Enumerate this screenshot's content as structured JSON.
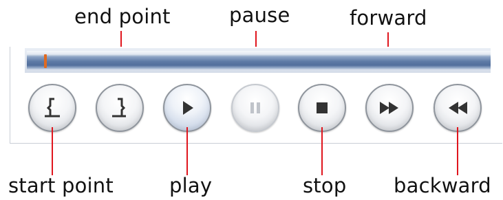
{
  "labels": {
    "end_point": "end point",
    "pause": "pause",
    "forward": "forward",
    "start_point": "start point",
    "play": "play",
    "stop": "stop",
    "backward": "backward"
  },
  "controls": [
    {
      "name": "start-point-button",
      "icon": "start-point-bracket-icon",
      "enabled": true
    },
    {
      "name": "end-point-button",
      "icon": "end-point-bracket-icon",
      "enabled": true
    },
    {
      "name": "play-button",
      "icon": "play-icon",
      "enabled": true
    },
    {
      "name": "pause-button",
      "icon": "pause-icon",
      "enabled": false
    },
    {
      "name": "stop-button",
      "icon": "stop-icon",
      "enabled": true
    },
    {
      "name": "forward-button",
      "icon": "fast-forward-icon",
      "enabled": true
    },
    {
      "name": "backward-button",
      "icon": "rewind-icon",
      "enabled": true
    }
  ],
  "colors": {
    "leader_line": "#e0151d",
    "slider_marker": "#e06a20",
    "track": "#5e7aa6",
    "icon": "#333333",
    "icon_disabled": "#c0c4ca"
  }
}
